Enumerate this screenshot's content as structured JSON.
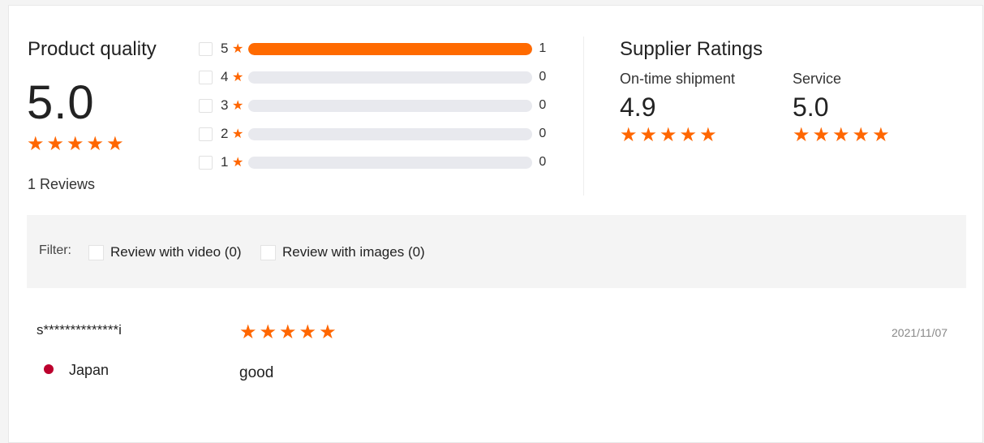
{
  "product_quality": {
    "title": "Product quality",
    "score": "5.0",
    "stars": 5,
    "reviews_label": "1 Reviews"
  },
  "breakdown": [
    {
      "stars": "5",
      "count": "1",
      "fill_fraction": 1.0
    },
    {
      "stars": "4",
      "count": "0",
      "fill_fraction": 0.0
    },
    {
      "stars": "3",
      "count": "0",
      "fill_fraction": 0.0
    },
    {
      "stars": "2",
      "count": "0",
      "fill_fraction": 0.0
    },
    {
      "stars": "1",
      "count": "0",
      "fill_fraction": 0.0
    }
  ],
  "supplier_ratings": {
    "title": "Supplier Ratings",
    "items": [
      {
        "label": "On-time shipment",
        "score": "4.9",
        "stars": 5
      },
      {
        "label": "Service",
        "score": "5.0",
        "stars": 5
      }
    ]
  },
  "filter": {
    "label": "Filter:",
    "options": [
      {
        "label": "Review with video (0)"
      },
      {
        "label": "Review with images (0)"
      }
    ]
  },
  "review": {
    "user": "s**************i",
    "country": "Japan",
    "stars": 5,
    "text": "good",
    "date": "2021/11/07"
  },
  "colors": {
    "accent": "#ff6600",
    "bar_fill": "#ff6a00",
    "bar_track": "#e8e9ee",
    "filter_bg": "#f4f4f4",
    "flag_red": "#bc002d"
  },
  "icons": {
    "star": "★"
  }
}
